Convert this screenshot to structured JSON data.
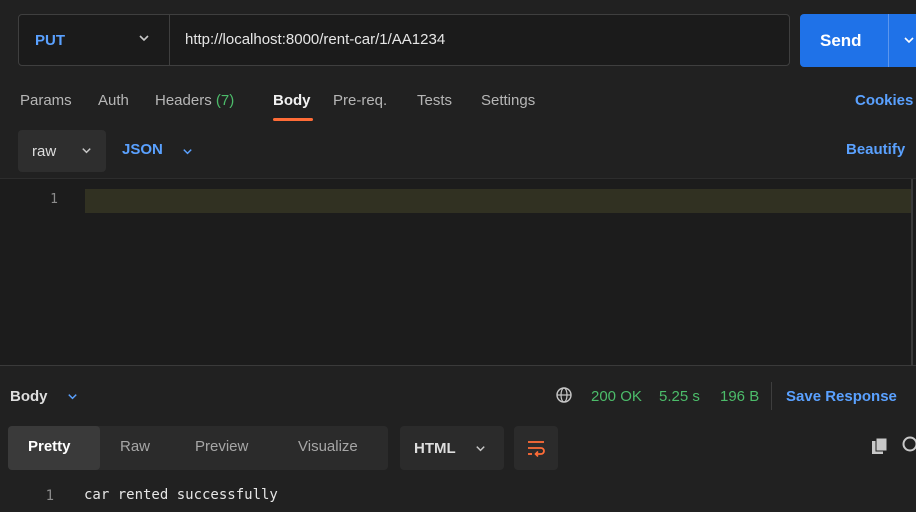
{
  "request": {
    "method": "PUT",
    "url": "http://localhost:8000/rent-car/1/AA1234",
    "send_label": "Send"
  },
  "request_tabs": [
    {
      "label": "Params"
    },
    {
      "label": "Auth"
    },
    {
      "label": "Headers",
      "count": "(7)"
    },
    {
      "label": "Body",
      "active": true
    },
    {
      "label": "Pre-req."
    },
    {
      "label": "Tests"
    },
    {
      "label": "Settings"
    }
  ],
  "cookies_label": "Cookies",
  "body_options": {
    "mode": "raw",
    "format": "JSON",
    "beautify_label": "Beautify"
  },
  "editor": {
    "line_numbers": [
      "1"
    ],
    "content": ""
  },
  "response": {
    "section_label": "Body",
    "status": "200 OK",
    "time": "5.25 s",
    "size": "196 B",
    "save_label": "Save Response",
    "view_tabs": [
      {
        "label": "Pretty",
        "active": true
      },
      {
        "label": "Raw"
      },
      {
        "label": "Preview"
      },
      {
        "label": "Visualize"
      }
    ],
    "format": "HTML",
    "line_number": "1",
    "content": "car rented successfully"
  },
  "colors": {
    "accent_blue": "#1f72e8",
    "link_blue": "#5aa1ff",
    "success_green": "#4cbc6a",
    "tab_underline": "#ff6c37",
    "wrap_icon": "#ff6c37"
  },
  "icons": [
    "chevron-down-icon",
    "globe-icon",
    "wrap-lines-icon",
    "copy-icon",
    "search-icon"
  ]
}
